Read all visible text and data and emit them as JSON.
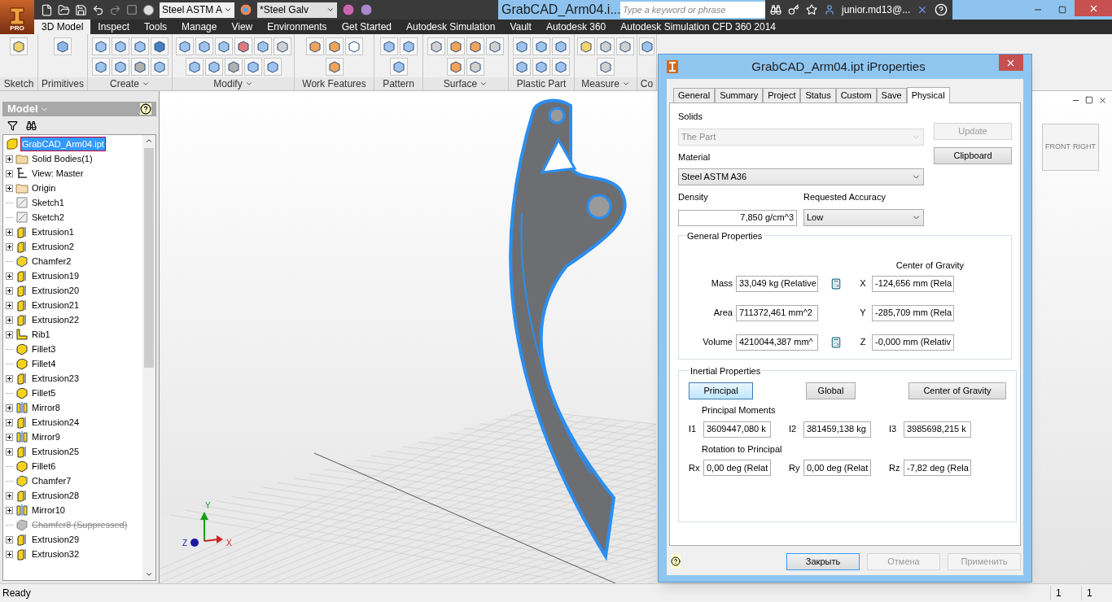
{
  "title_bar": {
    "app_label": "PRO",
    "material": "Steel ASTM A",
    "appearance": "*Steel Galv",
    "document_title": "GrabCAD_Arm04.i...",
    "search": {
      "placeholder": "Type a keyword or phrase"
    },
    "user": "junior.md13@..."
  },
  "ribbon_tabs": [
    {
      "label": "3D Model",
      "selected": true
    },
    {
      "label": "Inspect",
      "selected": false
    },
    {
      "label": "Tools",
      "selected": false
    },
    {
      "label": "Manage",
      "selected": false
    },
    {
      "label": "View",
      "selected": false
    },
    {
      "label": "Environments",
      "selected": false
    },
    {
      "label": "Get Started",
      "selected": false
    },
    {
      "label": "Autodesk Simulation",
      "selected": false
    },
    {
      "label": "Vault",
      "selected": false
    },
    {
      "label": "Autodesk 360",
      "selected": false
    },
    {
      "label": "Autodesk Simulation CFD 360 2014",
      "selected": false
    }
  ],
  "ribbon_groups": [
    {
      "label": "Sketch",
      "menu": false
    },
    {
      "label": "Primitives",
      "menu": false
    },
    {
      "label": "Create",
      "menu": true
    },
    {
      "label": "Modify",
      "menu": true
    },
    {
      "label": "Work Features",
      "menu": false
    },
    {
      "label": "Pattern",
      "menu": false
    },
    {
      "label": "Surface",
      "menu": true
    },
    {
      "label": "Plastic Part",
      "menu": false
    },
    {
      "label": "Measure",
      "menu": true
    },
    {
      "label": "Co",
      "menu": false
    }
  ],
  "browser": {
    "title": "Model",
    "items": [
      {
        "label": "GrabCAD_Arm04.ipt",
        "kind": "part",
        "collapsible": false,
        "selected": true,
        "suppressed": false
      },
      {
        "label": "Solid Bodies(1)",
        "kind": "bodies",
        "collapsible": true,
        "selected": false,
        "suppressed": false
      },
      {
        "label": "View: Master",
        "kind": "view",
        "collapsible": true,
        "selected": false,
        "suppressed": false
      },
      {
        "label": "Origin",
        "kind": "folder",
        "collapsible": true,
        "selected": false,
        "suppressed": false
      },
      {
        "label": "Sketch1",
        "kind": "sketch",
        "collapsible": false,
        "selected": false,
        "suppressed": false
      },
      {
        "label": "Sketch2",
        "kind": "sketch",
        "collapsible": false,
        "selected": false,
        "suppressed": false
      },
      {
        "label": "Extrusion1",
        "kind": "extrusion",
        "collapsible": true,
        "selected": false,
        "suppressed": false
      },
      {
        "label": "Extrusion2",
        "kind": "extrusion",
        "collapsible": true,
        "selected": false,
        "suppressed": false
      },
      {
        "label": "Chamfer2",
        "kind": "chamfer",
        "collapsible": false,
        "selected": false,
        "suppressed": false
      },
      {
        "label": "Extrusion19",
        "kind": "extrusion",
        "collapsible": true,
        "selected": false,
        "suppressed": false
      },
      {
        "label": "Extrusion20",
        "kind": "extrusion",
        "collapsible": true,
        "selected": false,
        "suppressed": false
      },
      {
        "label": "Extrusion21",
        "kind": "extrusion",
        "collapsible": true,
        "selected": false,
        "suppressed": false
      },
      {
        "label": "Extrusion22",
        "kind": "extrusion",
        "collapsible": true,
        "selected": false,
        "suppressed": false
      },
      {
        "label": "Rib1",
        "kind": "rib",
        "collapsible": true,
        "selected": false,
        "suppressed": false
      },
      {
        "label": "Fillet3",
        "kind": "fillet",
        "collapsible": false,
        "selected": false,
        "suppressed": false
      },
      {
        "label": "Fillet4",
        "kind": "fillet",
        "collapsible": false,
        "selected": false,
        "suppressed": false
      },
      {
        "label": "Extrusion23",
        "kind": "extrusion",
        "collapsible": true,
        "selected": false,
        "suppressed": false
      },
      {
        "label": "Fillet5",
        "kind": "fillet",
        "collapsible": false,
        "selected": false,
        "suppressed": false
      },
      {
        "label": "Mirror8",
        "kind": "mirror",
        "collapsible": true,
        "selected": false,
        "suppressed": false
      },
      {
        "label": "Extrusion24",
        "kind": "extrusion",
        "collapsible": true,
        "selected": false,
        "suppressed": false
      },
      {
        "label": "Mirror9",
        "kind": "mirror",
        "collapsible": true,
        "selected": false,
        "suppressed": false
      },
      {
        "label": "Extrusion25",
        "kind": "extrusion",
        "collapsible": true,
        "selected": false,
        "suppressed": false
      },
      {
        "label": "Fillet6",
        "kind": "fillet",
        "collapsible": false,
        "selected": false,
        "suppressed": false
      },
      {
        "label": "Chamfer7",
        "kind": "chamfer",
        "collapsible": false,
        "selected": false,
        "suppressed": false
      },
      {
        "label": "Extrusion28",
        "kind": "extrusion",
        "collapsible": true,
        "selected": false,
        "suppressed": false
      },
      {
        "label": "Mirror10",
        "kind": "mirror",
        "collapsible": true,
        "selected": false,
        "suppressed": false
      },
      {
        "label": "Chamfer8 (Suppressed)",
        "kind": "chamfer",
        "collapsible": false,
        "selected": false,
        "suppressed": true
      },
      {
        "label": "Extrusion29",
        "kind": "extrusion",
        "collapsible": true,
        "selected": false,
        "suppressed": false
      },
      {
        "label": "Extrusion32",
        "kind": "extrusion",
        "collapsible": true,
        "selected": false,
        "suppressed": false
      }
    ]
  },
  "viewport": {
    "view_cube": [
      "FRONT",
      "RIGHT"
    ],
    "axes": [
      "Y",
      "Z",
      "X"
    ]
  },
  "dialog": {
    "title": "GrabCAD_Arm04.ipt iProperties",
    "tabs": [
      {
        "label": "General",
        "selected": false
      },
      {
        "label": "Summary",
        "selected": false
      },
      {
        "label": "Project",
        "selected": false
      },
      {
        "label": "Status",
        "selected": false
      },
      {
        "label": "Custom",
        "selected": false
      },
      {
        "label": "Save",
        "selected": false
      },
      {
        "label": "Physical",
        "selected": true
      }
    ],
    "solids": {
      "label": "Solids",
      "value": "The Part",
      "disabled": true
    },
    "update": {
      "label": "Update",
      "disabled": true
    },
    "clipboard": {
      "label": "Clipboard",
      "disabled": false
    },
    "material": {
      "label": "Material",
      "value": "Steel ASTM A36"
    },
    "density": {
      "label": "Density",
      "value": "7,850 g/cm^3"
    },
    "accuracy": {
      "label": "Requested Accuracy",
      "value": "Low"
    },
    "general": {
      "title": "General Properties",
      "cog_title": "Center of Gravity",
      "rows": [
        {
          "label": "Mass",
          "value": "33,049 kg (Relative",
          "calculator": true,
          "axis": "X",
          "cog": "-124,656 mm (Rela"
        },
        {
          "label": "Area",
          "value": "711372,461 mm^2",
          "calculator": false,
          "axis": "Y",
          "cog": "-285,709 mm (Rela"
        },
        {
          "label": "Volume",
          "value": "4210044,387 mm^",
          "calculator": true,
          "axis": "Z",
          "cog": "-0,000 mm (Relativ"
        }
      ]
    },
    "inertial": {
      "title": "Inertial Properties",
      "modes": [
        {
          "label": "Principal",
          "selected": true
        },
        {
          "label": "Global",
          "selected": false
        },
        {
          "label": "Center of Gravity",
          "selected": false
        }
      ],
      "moments_title": "Principal Moments",
      "moments": [
        {
          "label": "I1",
          "value": "3609447,080 k"
        },
        {
          "label": "I2",
          "value": "381459,138 kg"
        },
        {
          "label": "I3",
          "value": "3985698,215 k"
        }
      ],
      "rotation_title": "Rotation to Principal",
      "rotations": [
        {
          "label": "Rx",
          "value": "0,00 deg (Relat"
        },
        {
          "label": "Ry",
          "value": "0,00 deg (Relat"
        },
        {
          "label": "Rz",
          "value": "-7,82 deg (Rela"
        }
      ]
    },
    "buttons": [
      {
        "label": "Закрыть",
        "disabled": false,
        "default": true
      },
      {
        "label": "Отмена",
        "disabled": true,
        "default": false
      },
      {
        "label": "Применить",
        "disabled": true,
        "default": false
      }
    ]
  },
  "status_bar": {
    "text": "Ready",
    "fields": [
      "1",
      "1"
    ]
  }
}
